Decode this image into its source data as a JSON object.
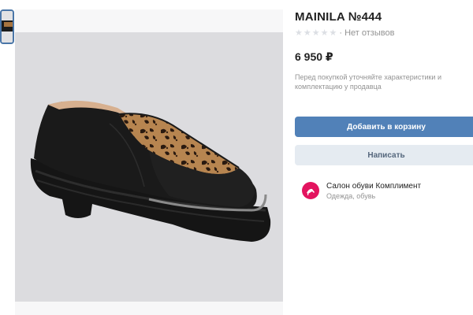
{
  "product": {
    "title": "MAINILA №444",
    "reviews_text": "· Нет отзывов",
    "rating_stars": 0,
    "rating_max": 5,
    "price": "6 950 ₽",
    "note": "Перед покупкой уточняйте характеристики и комплектацию у продавца"
  },
  "actions": {
    "add_to_cart": "Добавить в корзину",
    "write": "Написать"
  },
  "seller": {
    "name": "Салон обуви Комплимент",
    "category": "Одежда, обувь"
  },
  "colors": {
    "primary_button": "#5181b8",
    "secondary_button": "#e5ebf1",
    "avatar": "#e3145f",
    "muted_text": "#939393"
  }
}
